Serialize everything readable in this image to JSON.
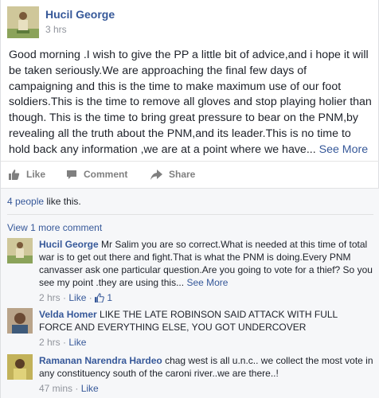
{
  "post": {
    "author": "Hucil George",
    "time": "3 hrs",
    "text": "Good morning .I wish to give the PP a little bit of advice,and i hope it will be taken seriously.We are approaching the final few days of campaigning and this is the time to make maximum use of our foot soldiers.This is the time to remove all gloves and stop playing holier than though. This is the time to bring great pressure to bear on the PNM,by revealing all the truth about the PNM,and its leader.This is no time to hold back any information ,we are at a point where we have...",
    "see_more": "See More"
  },
  "actions": {
    "like": "Like",
    "comment": "Comment",
    "share": "Share"
  },
  "likes": {
    "count": "4 people",
    "suffix": "like this."
  },
  "view_more_comments": "View 1 more comment",
  "comments": [
    {
      "author": "Hucil George",
      "text": "Mr Salim you are so correct.What is needed at this time of total war is to get out there and fight.That is what the PNM is doing.Every PNM canvasser ask one particular question.Are you going to vote for a thief? So you see my point .they are using this...",
      "see_more": "See More",
      "time": "2 hrs",
      "like_label": "Like",
      "like_count": "1"
    },
    {
      "author": "Velda Homer",
      "text": "LIKE THE LATE ROBINSON SAID ATTACK WITH FULL FORCE AND EVERYTHING ELSE, YOU GOT UNDERCOVER",
      "time": "2 hrs",
      "like_label": "Like"
    },
    {
      "author": "Ramanan Narendra Hardeo",
      "text": "chag west is all u.n.c.. we collect the most vote in any constituency south of the caroni river..we are there..!",
      "time": "47 mins",
      "like_label": "Like"
    }
  ],
  "colors": {
    "link": "#365899",
    "meta": "#90949c",
    "ufi_bg": "#f6f7f9"
  }
}
